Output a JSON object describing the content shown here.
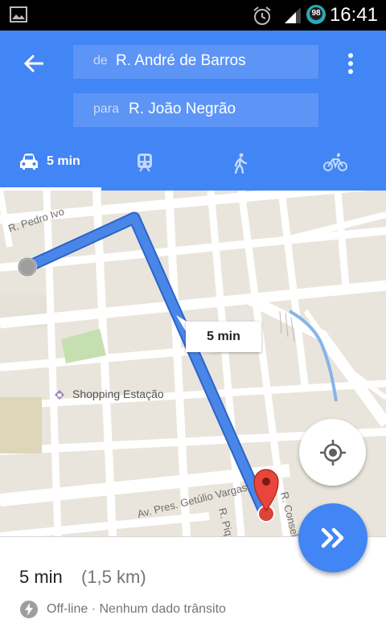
{
  "status_bar": {
    "time": "16:41",
    "battery_level": "98",
    "icons": [
      "image-icon",
      "alarm-icon",
      "signal-icon",
      "battery-icon"
    ]
  },
  "header": {
    "back_icon": "arrow-left-icon",
    "menu_icon": "more-vert-icon",
    "from": {
      "prefix": "de",
      "value": "R. André de Barros"
    },
    "to": {
      "prefix": "para",
      "value": "R. João Negrão"
    },
    "modes": [
      {
        "icon": "car-icon",
        "label": "5 min",
        "selected": true
      },
      {
        "icon": "train-icon",
        "label": ""
      },
      {
        "icon": "walk-icon",
        "label": ""
      },
      {
        "icon": "bike-icon",
        "label": ""
      }
    ]
  },
  "map": {
    "street_labels": [
      "R. Pedro Ivo",
      "Av. Pres. Getúlio Vargas",
      "R. Piquiri",
      "R. Conselheiro"
    ],
    "place_label": "Shopping Estação",
    "route_eta": "5 min"
  },
  "summary": {
    "duration": "5 min",
    "distance": "(1,5 km)",
    "traffic_status": "Off-line · Nenhum dado trânsito"
  },
  "colors": {
    "primary": "#4285f4",
    "route": "#4a86e8",
    "pin": "#db4437",
    "map_background": "#e9e5dc"
  }
}
